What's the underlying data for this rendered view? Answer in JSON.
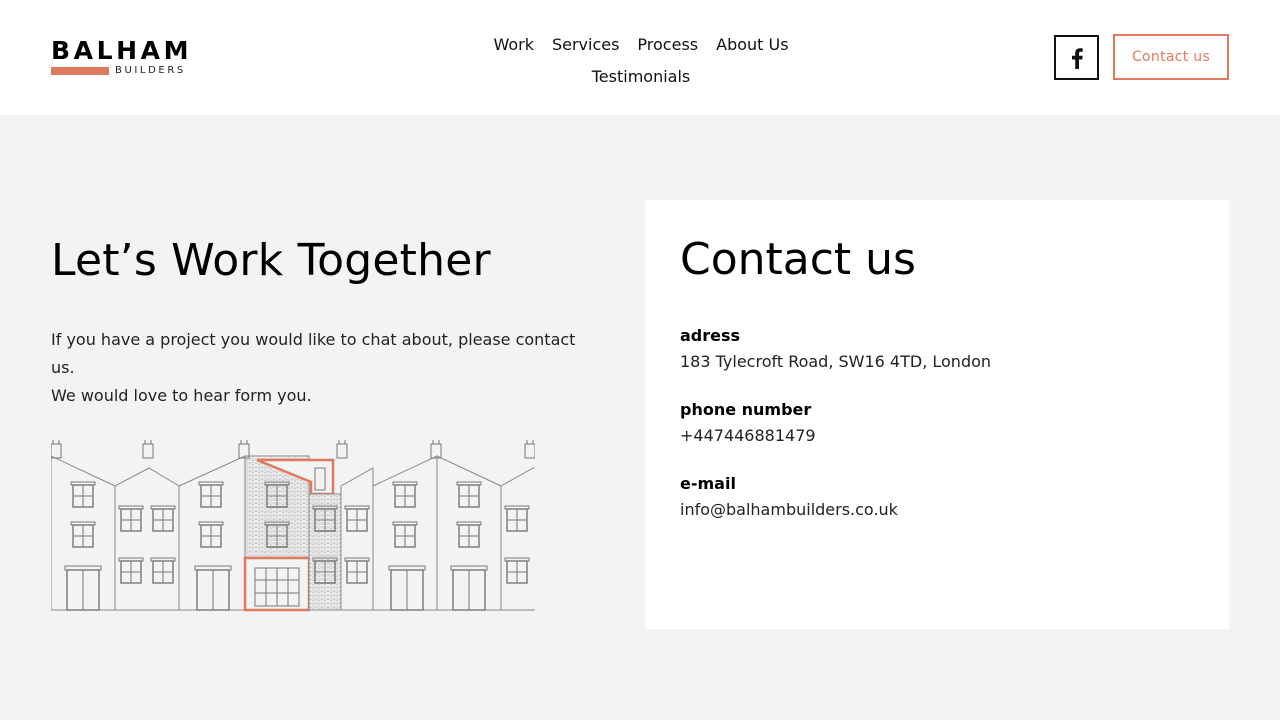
{
  "header": {
    "logo": {
      "name": "BALHAM",
      "sub": "BUILDERS",
      "accent_color": "#e07a5f"
    },
    "nav": {
      "items": [
        {
          "label": "Work"
        },
        {
          "label": "Services"
        },
        {
          "label": "Process"
        },
        {
          "label": "About Us"
        },
        {
          "label": "Testimonials"
        }
      ]
    },
    "social": {
      "icon": "facebook-icon"
    },
    "cta_label": "Contact us"
  },
  "intro": {
    "title": "Let’s Work Together",
    "text_line1": "If you have a project you would like to chat about, please contact us.",
    "text_line2": "We would love to hear form you."
  },
  "contact": {
    "title": "Contact us",
    "address_label": "adress",
    "address_value": "183 Tylecroft Road, SW16 4TD, London",
    "phone_label": "phone number",
    "phone_value": "+447446881479",
    "email_label": "e-mail",
    "email_value": "info@balhambuilders.co.uk"
  },
  "colors": {
    "accent": "#e07a5f",
    "page_background": "#f3f3f3",
    "card_background": "#ffffff"
  }
}
